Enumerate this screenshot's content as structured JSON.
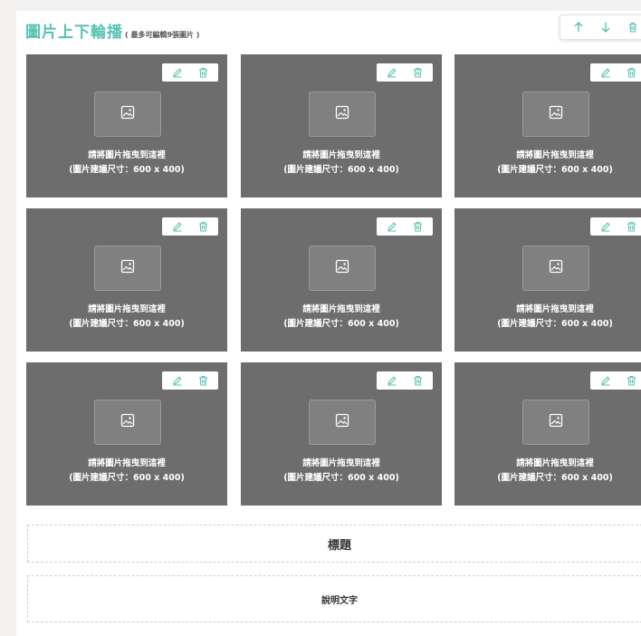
{
  "header": {
    "title": "圖片上下輪播",
    "note": "( 最多可編輯9張圖片 )"
  },
  "toolbar": {
    "icons": [
      "arrow-up-icon",
      "arrow-down-icon",
      "trash-icon"
    ]
  },
  "cards": [
    {
      "line1": "請將圖片拖曳到這裡",
      "line2": "(圖片建議尺寸：600 x 400)"
    },
    {
      "line1": "請將圖片拖曳到這裡",
      "line2": "(圖片建議尺寸：600 x 400)"
    },
    {
      "line1": "請將圖片拖曳到這裡",
      "line2": "(圖片建議尺寸：600 x 400)"
    },
    {
      "line1": "請將圖片拖曳到這裡",
      "line2": "(圖片建議尺寸：600 x 400)"
    },
    {
      "line1": "請將圖片拖曳到這裡",
      "line2": "(圖片建議尺寸：600 x 400)"
    },
    {
      "line1": "請將圖片拖曳到這裡",
      "line2": "(圖片建議尺寸：600 x 400)"
    },
    {
      "line1": "請將圖片拖曳到這裡",
      "line2": "(圖片建議尺寸：600 x 400)"
    },
    {
      "line1": "請將圖片拖曳到這裡",
      "line2": "(圖片建議尺寸：600 x 400)"
    },
    {
      "line1": "請將圖片拖曳到這裡",
      "line2": "(圖片建議尺寸：600 x 400)"
    }
  ],
  "fields": {
    "title_placeholder": "標題",
    "desc_placeholder": "說明文字"
  },
  "colors": {
    "accent": "#56c3b2",
    "card_bg": "#6d6d6d"
  }
}
